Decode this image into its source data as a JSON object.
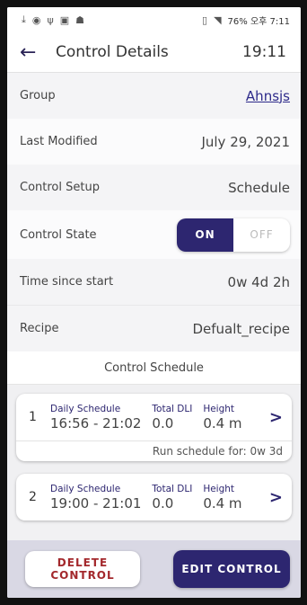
{
  "status_bar": {
    "left_icons": [
      "download-icon",
      "record-icon",
      "usb-icon",
      "image-icon",
      "android-icon"
    ],
    "right_text": "76% 오후 7:11"
  },
  "header": {
    "title": "Control Details",
    "time": "19:11"
  },
  "rows": [
    {
      "label": "Group",
      "value": "Ahnsjs"
    },
    {
      "label": "Last Modified",
      "value": "July 29, 2021"
    },
    {
      "label": "Control Setup",
      "value": "Schedule"
    },
    {
      "label": "Control State",
      "on": "ON",
      "off": "OFF",
      "state": "on"
    },
    {
      "label": "Time since start",
      "value": "0w 4d 2h"
    },
    {
      "label": "Recipe",
      "value": "Defualt_recipe"
    }
  ],
  "schedule": {
    "title": "Control Schedule",
    "cards": [
      {
        "index": "1",
        "schedule_label": "Daily Schedule",
        "schedule_value": "16:56 - 21:02",
        "dli_label": "Total DLI",
        "dli_value": "0.0",
        "height_label": "Height",
        "height_value": "0.4 m",
        "footer": "Run schedule for: 0w 3d"
      },
      {
        "index": "2",
        "schedule_label": "Daily Schedule",
        "schedule_value": "19:00 - 21:01",
        "dli_label": "Total DLI",
        "dli_value": "0.0",
        "height_label": "Height",
        "height_value": "0.4 m"
      }
    ]
  },
  "actions": {
    "delete": "DELETE CONTROL",
    "edit": "EDIT CONTROL"
  },
  "colors": {
    "primary": "#2d2670",
    "danger": "#a3282c"
  }
}
